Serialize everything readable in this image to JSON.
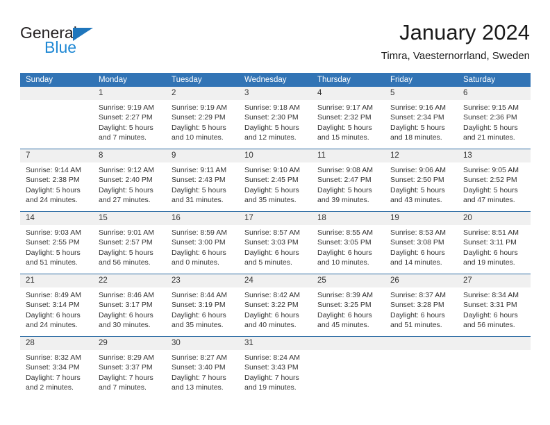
{
  "brand": {
    "name_part1": "General",
    "name_part2": "Blue",
    "triangle_icon": "triangle-icon",
    "accent_color": "#1f76bc",
    "blue_text_color": "#1f88d4"
  },
  "header": {
    "title": "January 2024",
    "subtitle": "Timra, Vaesternorrland, Sweden"
  },
  "calendar": {
    "header_bg_color": "#3274b5",
    "row_border_color": "#2e6da4",
    "daynum_bg_color": "#f0f0f0",
    "weekday_headers": [
      "Sunday",
      "Monday",
      "Tuesday",
      "Wednesday",
      "Thursday",
      "Friday",
      "Saturday"
    ],
    "weeks": [
      [
        {
          "day": "",
          "sunrise": "",
          "sunset": "",
          "daylight_line1": "",
          "daylight_line2": "",
          "empty": true
        },
        {
          "day": "1",
          "sunrise": "Sunrise: 9:19 AM",
          "sunset": "Sunset: 2:27 PM",
          "daylight_line1": "Daylight: 5 hours",
          "daylight_line2": "and 7 minutes.",
          "empty": false
        },
        {
          "day": "2",
          "sunrise": "Sunrise: 9:19 AM",
          "sunset": "Sunset: 2:29 PM",
          "daylight_line1": "Daylight: 5 hours",
          "daylight_line2": "and 10 minutes.",
          "empty": false
        },
        {
          "day": "3",
          "sunrise": "Sunrise: 9:18 AM",
          "sunset": "Sunset: 2:30 PM",
          "daylight_line1": "Daylight: 5 hours",
          "daylight_line2": "and 12 minutes.",
          "empty": false
        },
        {
          "day": "4",
          "sunrise": "Sunrise: 9:17 AM",
          "sunset": "Sunset: 2:32 PM",
          "daylight_line1": "Daylight: 5 hours",
          "daylight_line2": "and 15 minutes.",
          "empty": false
        },
        {
          "day": "5",
          "sunrise": "Sunrise: 9:16 AM",
          "sunset": "Sunset: 2:34 PM",
          "daylight_line1": "Daylight: 5 hours",
          "daylight_line2": "and 18 minutes.",
          "empty": false
        },
        {
          "day": "6",
          "sunrise": "Sunrise: 9:15 AM",
          "sunset": "Sunset: 2:36 PM",
          "daylight_line1": "Daylight: 5 hours",
          "daylight_line2": "and 21 minutes.",
          "empty": false
        }
      ],
      [
        {
          "day": "7",
          "sunrise": "Sunrise: 9:14 AM",
          "sunset": "Sunset: 2:38 PM",
          "daylight_line1": "Daylight: 5 hours",
          "daylight_line2": "and 24 minutes.",
          "empty": false
        },
        {
          "day": "8",
          "sunrise": "Sunrise: 9:12 AM",
          "sunset": "Sunset: 2:40 PM",
          "daylight_line1": "Daylight: 5 hours",
          "daylight_line2": "and 27 minutes.",
          "empty": false
        },
        {
          "day": "9",
          "sunrise": "Sunrise: 9:11 AM",
          "sunset": "Sunset: 2:43 PM",
          "daylight_line1": "Daylight: 5 hours",
          "daylight_line2": "and 31 minutes.",
          "empty": false
        },
        {
          "day": "10",
          "sunrise": "Sunrise: 9:10 AM",
          "sunset": "Sunset: 2:45 PM",
          "daylight_line1": "Daylight: 5 hours",
          "daylight_line2": "and 35 minutes.",
          "empty": false
        },
        {
          "day": "11",
          "sunrise": "Sunrise: 9:08 AM",
          "sunset": "Sunset: 2:47 PM",
          "daylight_line1": "Daylight: 5 hours",
          "daylight_line2": "and 39 minutes.",
          "empty": false
        },
        {
          "day": "12",
          "sunrise": "Sunrise: 9:06 AM",
          "sunset": "Sunset: 2:50 PM",
          "daylight_line1": "Daylight: 5 hours",
          "daylight_line2": "and 43 minutes.",
          "empty": false
        },
        {
          "day": "13",
          "sunrise": "Sunrise: 9:05 AM",
          "sunset": "Sunset: 2:52 PM",
          "daylight_line1": "Daylight: 5 hours",
          "daylight_line2": "and 47 minutes.",
          "empty": false
        }
      ],
      [
        {
          "day": "14",
          "sunrise": "Sunrise: 9:03 AM",
          "sunset": "Sunset: 2:55 PM",
          "daylight_line1": "Daylight: 5 hours",
          "daylight_line2": "and 51 minutes.",
          "empty": false
        },
        {
          "day": "15",
          "sunrise": "Sunrise: 9:01 AM",
          "sunset": "Sunset: 2:57 PM",
          "daylight_line1": "Daylight: 5 hours",
          "daylight_line2": "and 56 minutes.",
          "empty": false
        },
        {
          "day": "16",
          "sunrise": "Sunrise: 8:59 AM",
          "sunset": "Sunset: 3:00 PM",
          "daylight_line1": "Daylight: 6 hours",
          "daylight_line2": "and 0 minutes.",
          "empty": false
        },
        {
          "day": "17",
          "sunrise": "Sunrise: 8:57 AM",
          "sunset": "Sunset: 3:03 PM",
          "daylight_line1": "Daylight: 6 hours",
          "daylight_line2": "and 5 minutes.",
          "empty": false
        },
        {
          "day": "18",
          "sunrise": "Sunrise: 8:55 AM",
          "sunset": "Sunset: 3:05 PM",
          "daylight_line1": "Daylight: 6 hours",
          "daylight_line2": "and 10 minutes.",
          "empty": false
        },
        {
          "day": "19",
          "sunrise": "Sunrise: 8:53 AM",
          "sunset": "Sunset: 3:08 PM",
          "daylight_line1": "Daylight: 6 hours",
          "daylight_line2": "and 14 minutes.",
          "empty": false
        },
        {
          "day": "20",
          "sunrise": "Sunrise: 8:51 AM",
          "sunset": "Sunset: 3:11 PM",
          "daylight_line1": "Daylight: 6 hours",
          "daylight_line2": "and 19 minutes.",
          "empty": false
        }
      ],
      [
        {
          "day": "21",
          "sunrise": "Sunrise: 8:49 AM",
          "sunset": "Sunset: 3:14 PM",
          "daylight_line1": "Daylight: 6 hours",
          "daylight_line2": "and 24 minutes.",
          "empty": false
        },
        {
          "day": "22",
          "sunrise": "Sunrise: 8:46 AM",
          "sunset": "Sunset: 3:17 PM",
          "daylight_line1": "Daylight: 6 hours",
          "daylight_line2": "and 30 minutes.",
          "empty": false
        },
        {
          "day": "23",
          "sunrise": "Sunrise: 8:44 AM",
          "sunset": "Sunset: 3:19 PM",
          "daylight_line1": "Daylight: 6 hours",
          "daylight_line2": "and 35 minutes.",
          "empty": false
        },
        {
          "day": "24",
          "sunrise": "Sunrise: 8:42 AM",
          "sunset": "Sunset: 3:22 PM",
          "daylight_line1": "Daylight: 6 hours",
          "daylight_line2": "and 40 minutes.",
          "empty": false
        },
        {
          "day": "25",
          "sunrise": "Sunrise: 8:39 AM",
          "sunset": "Sunset: 3:25 PM",
          "daylight_line1": "Daylight: 6 hours",
          "daylight_line2": "and 45 minutes.",
          "empty": false
        },
        {
          "day": "26",
          "sunrise": "Sunrise: 8:37 AM",
          "sunset": "Sunset: 3:28 PM",
          "daylight_line1": "Daylight: 6 hours",
          "daylight_line2": "and 51 minutes.",
          "empty": false
        },
        {
          "day": "27",
          "sunrise": "Sunrise: 8:34 AM",
          "sunset": "Sunset: 3:31 PM",
          "daylight_line1": "Daylight: 6 hours",
          "daylight_line2": "and 56 minutes.",
          "empty": false
        }
      ],
      [
        {
          "day": "28",
          "sunrise": "Sunrise: 8:32 AM",
          "sunset": "Sunset: 3:34 PM",
          "daylight_line1": "Daylight: 7 hours",
          "daylight_line2": "and 2 minutes.",
          "empty": false
        },
        {
          "day": "29",
          "sunrise": "Sunrise: 8:29 AM",
          "sunset": "Sunset: 3:37 PM",
          "daylight_line1": "Daylight: 7 hours",
          "daylight_line2": "and 7 minutes.",
          "empty": false
        },
        {
          "day": "30",
          "sunrise": "Sunrise: 8:27 AM",
          "sunset": "Sunset: 3:40 PM",
          "daylight_line1": "Daylight: 7 hours",
          "daylight_line2": "and 13 minutes.",
          "empty": false
        },
        {
          "day": "31",
          "sunrise": "Sunrise: 8:24 AM",
          "sunset": "Sunset: 3:43 PM",
          "daylight_line1": "Daylight: 7 hours",
          "daylight_line2": "and 19 minutes.",
          "empty": false
        },
        {
          "day": "",
          "sunrise": "",
          "sunset": "",
          "daylight_line1": "",
          "daylight_line2": "",
          "empty": true
        },
        {
          "day": "",
          "sunrise": "",
          "sunset": "",
          "daylight_line1": "",
          "daylight_line2": "",
          "empty": true
        },
        {
          "day": "",
          "sunrise": "",
          "sunset": "",
          "daylight_line1": "",
          "daylight_line2": "",
          "empty": true
        }
      ]
    ]
  }
}
